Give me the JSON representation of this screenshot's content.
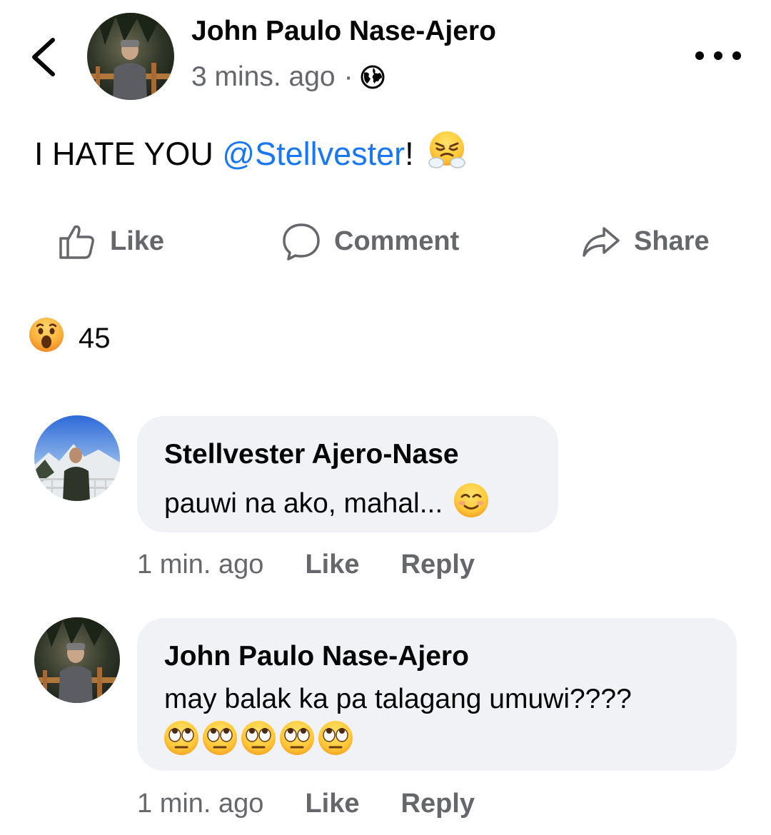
{
  "post": {
    "author": "John Paulo Nase-Ajero",
    "time": "3 mins. ago",
    "separator": "·",
    "privacy_icon": "globe-icon",
    "text_prefix": "I HATE YOU ",
    "mention": "@Stellvester",
    "text_suffix": "!",
    "emoji": "face-with-steam-from-nose"
  },
  "actions": {
    "like": "Like",
    "comment": "Comment",
    "share": "Share"
  },
  "reactions": {
    "emoji": "wow",
    "count": "45"
  },
  "comments": [
    {
      "author": "Stellvester Ajero-Nase",
      "text": "pauwi na ako, mahal...",
      "emoji": "smiling-face",
      "time": "1 min. ago",
      "like_label": "Like",
      "reply_label": "Reply"
    },
    {
      "author": "John Paulo Nase-Ajero",
      "text": "may balak ka pa talagang umuwi????",
      "emoji": "face-with-rolling-eyes x5",
      "time": "1 min. ago",
      "like_label": "Like",
      "reply_label": "Reply"
    }
  ],
  "colors": {
    "mention": "#1877f2",
    "secondary_text": "#65676b",
    "bubble": "#f0f2f5"
  }
}
